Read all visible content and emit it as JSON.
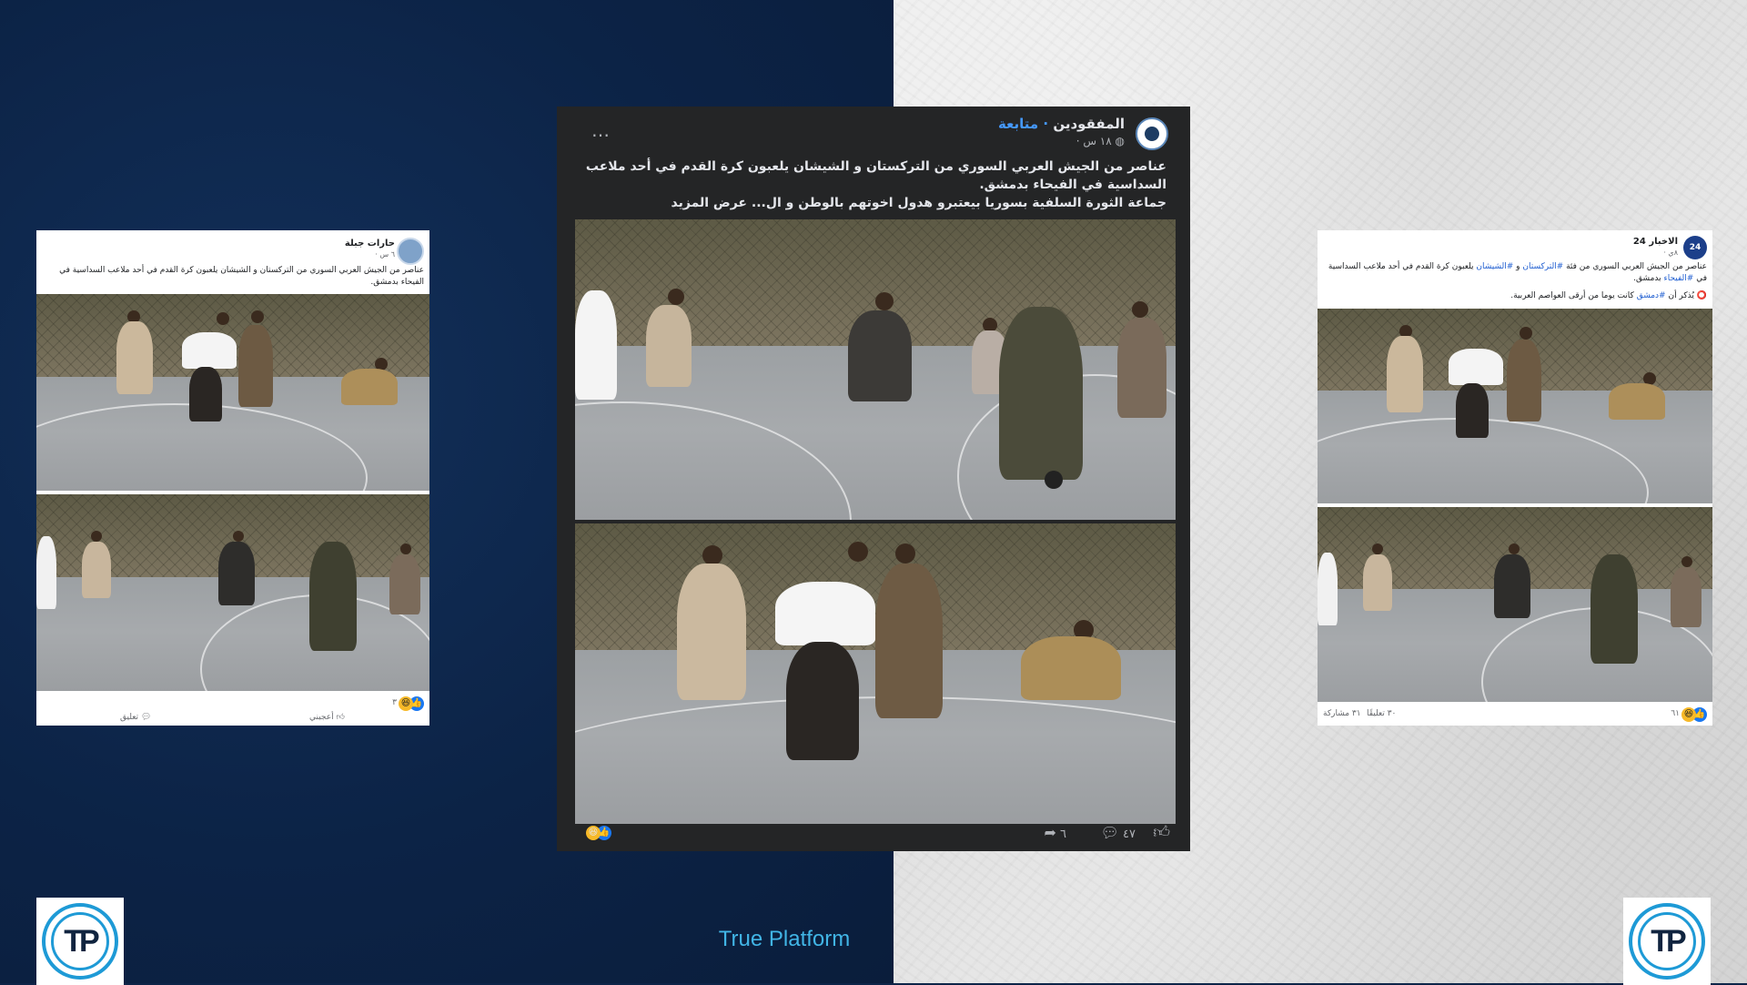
{
  "brand": {
    "footer_text": "True Platform",
    "logo_text": "TP"
  },
  "center_post": {
    "author": "المفقودين",
    "follow": "· متابعة",
    "time": "١٨ س ·",
    "text_line1": "عناصر من الجيش العربي السوري من التركستان و الشيشان يلعبون كرة القدم في أحد ملاعب السداسية في الفيحاء بدمشق.",
    "text_line2": "جماعة الثورة السلفية بسوريا بيعتبرو هدول اخوتهم بالوطن و ال...",
    "see_more": "عرض المزيد",
    "more_icon": "…",
    "comments_count": "٤٧",
    "shares_count": "٦"
  },
  "left_post": {
    "author": "حارات جبلة",
    "time": "٦ س ·",
    "text": "عناصر من الجيش العربي السوري من التركستان و الشيشان يلعبون كرة القدم في أحد ملاعب السداسية في الفيحاء بدمشق.",
    "reactions_count": "٣",
    "like_label": "أعجبني",
    "comment_label": "تعليق"
  },
  "right_post": {
    "author": "الاخبار 24",
    "time": "٨ي ·",
    "text_pre": "عناصر من الجيش العربي السوري من فئة ",
    "tag1": "#التركستان",
    "text_mid": " و ",
    "tag2": "#الشيشان",
    "text_post": " يلعبون كرة القدم في أحد ملاعب السداسية في ",
    "tag3": "#الفيحاء",
    "text_end": " بدمشق.",
    "note_pre": "يُذكر أن ",
    "note_tag": "#دمشق",
    "note_post": " كانت يوما من أرقى العواصم العربية.",
    "reactions_count": "٦١",
    "comments_count": "٣٠ تعليقًا",
    "shares_count": "٣١ مشاركة"
  },
  "colors": {
    "accent": "#41b5e6",
    "left_bg": "#0d2448",
    "post_dark": "#242526",
    "link": "#1f5ed1"
  }
}
